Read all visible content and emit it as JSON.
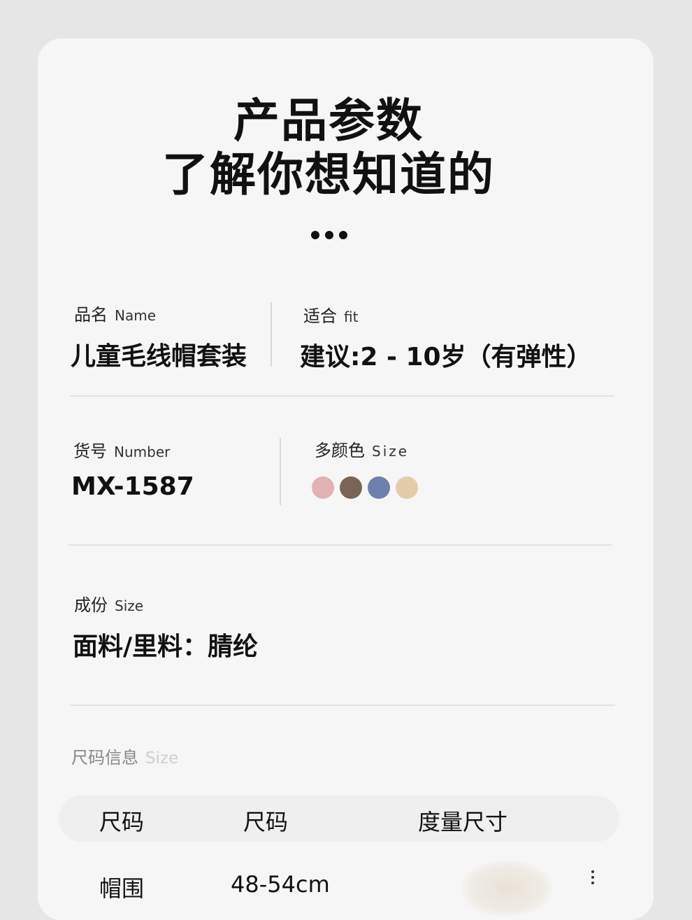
{
  "header": {
    "title_line1": "产品参数",
    "title_line2": "了解你想知道的"
  },
  "specs": {
    "name": {
      "label": "品名",
      "label_en": "Name",
      "value": "儿童毛线帽套装"
    },
    "fit": {
      "label": "适合",
      "label_en": "fit",
      "value": "建议:2 - 10岁（有弹性）"
    },
    "number": {
      "label": "货号",
      "label_en": "Number",
      "value": "MX-1587"
    },
    "colors": {
      "label": "多颜色",
      "label_en": "Size",
      "swatches": [
        "#e2b2b2",
        "#7a6455",
        "#6f7fae",
        "#e4ccaa"
      ]
    },
    "material": {
      "label": "成份",
      "label_en": "Size",
      "value": "面料/里料：腈纶"
    }
  },
  "size_info": {
    "heading": "尺码信息",
    "heading_en": "Size",
    "columns": [
      "尺码",
      "尺码",
      "度量尺寸"
    ],
    "rows": [
      {
        "c1": "帽围",
        "c2": "48-54cm"
      }
    ]
  }
}
